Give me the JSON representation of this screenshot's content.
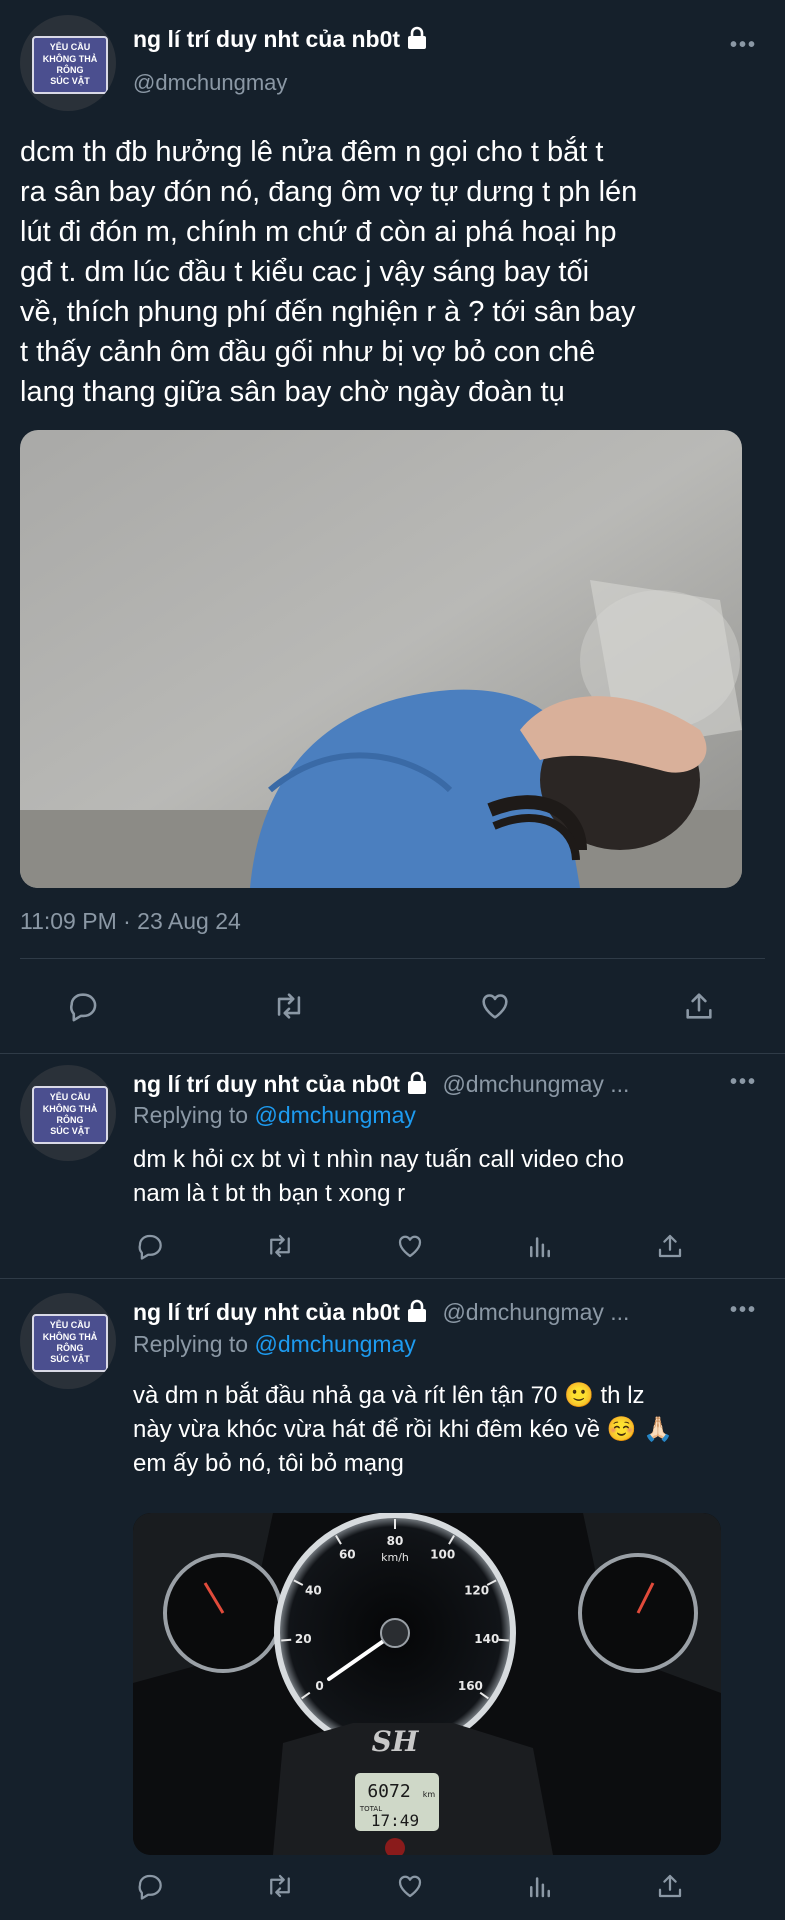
{
  "main_tweet": {
    "avatar_sign": [
      "YÊU CẦU",
      "KHÔNG THẢ RÔNG",
      "SÚC VẬT"
    ],
    "author_name": "ng lí trí duy nht của nb0t",
    "handle": "@dmchungmay",
    "text": "dcm th đb hưởng lê nửa đêm n gọi cho t bắt t\nra sân bay đón nó, đang ôm vợ tự dưng t ph lén\nlút đi đón m, chính m chứ đ còn ai phá hoại hp\ngđ t. dm lúc đầu t kiểu cac j vậy sáng bay tối\nvề, thích phung phí đến nghiện r à ? tới sân bay\nt thấy cảnh ôm đầu gối như bị vợ bỏ con chê\nlang thang giữa sân bay chờ ngày đoàn tụ",
    "timestamp": "11:09 PM · 23 Aug 24"
  },
  "replies": [
    {
      "avatar_sign": [
        "YÊU CẦU",
        "KHÔNG THẢ RÔNG",
        "SÚC VẬT"
      ],
      "author_name": "ng lí trí duy nht của nb0t",
      "handle": "@dmchungmay ...",
      "replying_label": "Replying to",
      "replying_handle": "@dmchungmay",
      "text": "dm k hỏi cx bt vì t nhìn nay tuấn call video cho\nnam là t bt th bạn t xong r"
    },
    {
      "avatar_sign": [
        "YÊU CẦU",
        "KHÔNG THẢ RÔNG",
        "SÚC VẬT"
      ],
      "author_name": "ng lí trí duy nht của nb0t",
      "handle": "@dmchungmay ...",
      "replying_label": "Replying to",
      "replying_handle": "@dmchungmay",
      "text": "và dm n bắt đầu nhả ga và rít lên tận 70 🙂  th lz\nnày vừa khóc vừa hát để rồi khi đêm kéo về ☺️ 🙏🏻\nem ấy bỏ nó, tôi bỏ mạng",
      "gauge": {
        "brand": "SH",
        "unit": "km/h",
        "ticks": [
          "0",
          "20",
          "40",
          "60",
          "80",
          "100",
          "120",
          "140",
          "160"
        ],
        "odometer": "6072",
        "odometer_unit": "km",
        "total_label": "TOTAL",
        "clock": "17:49"
      }
    }
  ],
  "icons": {
    "reply": "reply-icon",
    "retweet": "retweet-icon",
    "like": "like-icon",
    "views": "views-icon",
    "share": "share-icon",
    "lock": "lock-icon",
    "more": "more-icon"
  },
  "colors": {
    "background": "#15202b",
    "text": "#ffffff",
    "muted": "#8b98a5",
    "link": "#1d9bf0",
    "divider": "#2f3b47"
  }
}
